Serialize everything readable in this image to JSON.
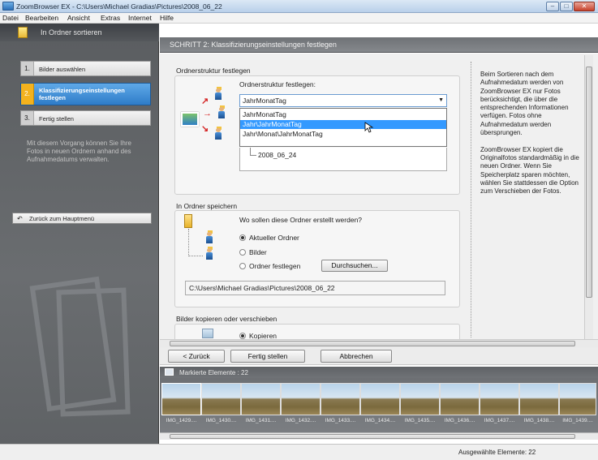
{
  "window": {
    "title": "ZoomBrowser EX - C:\\Users\\Michael Gradias\\Pictures\\2008_06_22",
    "min": "–",
    "max": "□",
    "close": "✕"
  },
  "menu": [
    "Datei",
    "Bearbeiten",
    "Ansicht",
    "Extras",
    "Internet",
    "Hilfe"
  ],
  "left": {
    "header": "In Ordner sortieren",
    "steps": [
      {
        "num": "1.",
        "label": "Bilder auswählen"
      },
      {
        "num": "2.",
        "label": "Klassifizierungseinstellungen festlegen"
      },
      {
        "num": "3.",
        "label": "Fertig stellen"
      }
    ],
    "info": "Mit diesem Vorgang können Sie Ihre Fotos in neuen Ordnern anhand des Aufnahmedatums verwalten.",
    "back_button": "Zurück zum Hauptmenü"
  },
  "main": {
    "header": "SCHRITT 2: Klassifizierungseinstellungen festlegen",
    "section1": {
      "title": "Ordnerstruktur festlegen",
      "label": "Ordnerstruktur festlegen:",
      "selected": "JahrMonatTag",
      "options": [
        "JahrMonatTag",
        "Jahr\\JahrMonatTag",
        "Jahr\\Monat\\JahrMonatTag"
      ],
      "tree_item": "2008_06_24"
    },
    "section2": {
      "title": "In Ordner speichern",
      "question": "Wo sollen diese Ordner erstellt werden?",
      "radios": [
        {
          "label": "Aktueller Ordner",
          "checked": true
        },
        {
          "label": "Bilder",
          "checked": false
        },
        {
          "label": "Ordner festlegen",
          "checked": false
        }
      ],
      "browse_button": "Durchsuchen...",
      "path": "C:\\Users\\Michael Gradias\\Pictures\\2008_06_22"
    },
    "section3": {
      "title": "Bilder kopieren oder verschieben",
      "partial": "Kopieren"
    },
    "info_text": "Beim Sortieren nach dem Aufnahmedatum werden von ZoomBrowser EX nur Fotos berücksichtigt, die über die entsprechenden Informationen verfügen. Fotos ohne Aufnahmedatum werden übersprungen.\n\nZoomBrowser EX kopiert die Originalfotos standardmäßig in die neuen Ordner. Wenn Sie Speicherplatz sparen möchten, wählen Sie stattdessen die Option zum Verschieben der Fotos."
  },
  "nav": {
    "back": "< Zurück",
    "finish": "Fertig stellen",
    "cancel": "Abbrechen"
  },
  "strip": {
    "header": "Markierte Elemente : 22",
    "thumbs": [
      "IMG_1429....",
      "IMG_1430....",
      "IMG_1431....",
      "IMG_1432....",
      "IMG_1433....",
      "IMG_1434....",
      "IMG_1435....",
      "IMG_1436....",
      "IMG_1437....",
      "IMG_1438....",
      "IMG_1439...."
    ]
  },
  "status": "Ausgewählte Elemente: 22"
}
